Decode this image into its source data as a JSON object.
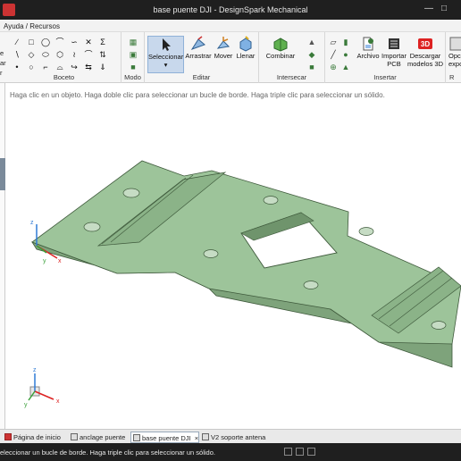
{
  "window": {
    "title": "base puente DJI - DesignSpark Mechanical"
  },
  "menu": {
    "item": "Ayuda / Recursos"
  },
  "ribbon": {
    "groups": {
      "boceto": "Boceto",
      "modo": "Modo",
      "editar": "Editar",
      "intersecar": "Intersecar",
      "insertar": "Insertar"
    },
    "buttons": {
      "seleccionar": "Seleccionar",
      "arrastrar": "Arrastrar",
      "mover": "Mover",
      "llenar": "Llenar",
      "combinar": "Combinar",
      "archivo": "Archivo",
      "importar_pcb_1": "Importar",
      "importar_pcb_2": "PCB",
      "descargar_1": "Descargar",
      "descargar_2": "modelos 3D",
      "opciones_1": "Opc",
      "opciones_2": "expo",
      "opciones_3": "R"
    },
    "left_cut_labels": [
      "e",
      "ar",
      "r"
    ]
  },
  "viewport": {
    "hint": "Haga clic en un objeto. Haga doble clic para seleccionar un bucle de borde. Haga triple clic para seleccionar un sólido.",
    "triad": {
      "x": "x",
      "y": "y",
      "z": "z"
    },
    "cube_triad": {
      "x": "x",
      "y": "y",
      "z": "z"
    },
    "colors": {
      "part": "#9dc49a",
      "part_edge": "#3f5a3c",
      "accent": "#2f7bd6"
    }
  },
  "doc_tabs": [
    {
      "label": "Página de inicio",
      "active": false
    },
    {
      "label": "anclage puente",
      "active": false
    },
    {
      "label": "base puente DJI",
      "active": true,
      "close": "×"
    },
    {
      "label": "V2 soporte antena",
      "active": false
    }
  ],
  "status": {
    "text": "eleccionar un bucle de borde. Haga triple clic para seleccionar un sólido."
  }
}
